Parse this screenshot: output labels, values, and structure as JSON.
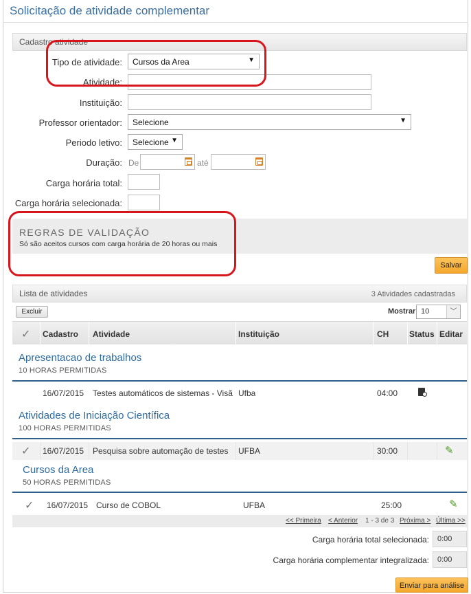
{
  "page": {
    "title": "Solicitação de atividade complementar"
  },
  "cadastro": {
    "section_title": "Cadastro atividade",
    "tipo_label": "Tipo de atividade:",
    "tipo_value": "Cursos da Area",
    "atividade_label": "Atividade:",
    "instituicao_label": "Instituição:",
    "professor_label": "Professor orientador:",
    "professor_value": "Selecione",
    "periodo_label": "Periodo letivo:",
    "periodo_value": "Selecione",
    "duracao_label": "Duração:",
    "de_label": "De",
    "ate_label": "até",
    "carga_total_label": "Carga horária total:",
    "carga_sel_label": "Carga horária selecionada:"
  },
  "regras": {
    "title": "REGRAS DE VALIDAÇÃO",
    "text": "Só são aceitos cursos com carga horária de 20 horas ou mais"
  },
  "save_label": "Salvar",
  "lista": {
    "section_title": "Lista de atividades",
    "count_text": "3 Atividades cadastradas",
    "excluir_label": "Excluir",
    "mostrar_label": "Mostrar",
    "mostrar_value": "10",
    "columns": {
      "cadastro": "Cadastro",
      "atividade": "Atividade",
      "instituicao": "Instituição",
      "ch": "CH",
      "status": "Status",
      "editar": "Editar"
    },
    "groups": [
      {
        "title": "Apresentacao de trabalhos",
        "subtitle": "10 HORAS PERMITIDAS",
        "rows": [
          {
            "date": "16/07/2015",
            "activity": "Testes automáticos de sistemas - Visã...",
            "institution": "Ufba",
            "ch": "04:00",
            "checked": false,
            "status_icon": "document-search-icon",
            "editable": false
          }
        ]
      },
      {
        "title": "Atividades de Iniciação Científica",
        "subtitle": "100 HORAS PERMITIDAS",
        "rows": [
          {
            "date": "16/07/2015",
            "activity": "Pesquisa sobre automação de testes",
            "institution": "UFBA",
            "ch": "30:00",
            "checked": true,
            "status_icon": "",
            "editable": true
          }
        ]
      },
      {
        "title": "Cursos da Area",
        "subtitle": "50 HORAS PERMITIDAS",
        "rows": [
          {
            "date": "16/07/2015",
            "activity": "Curso de COBOL",
            "institution": "UFBA",
            "ch": "25:00",
            "checked": true,
            "status_icon": "",
            "editable": true
          }
        ]
      }
    ],
    "pager": {
      "first": "<< Primeira",
      "prev": "< Anterior",
      "info": "1 - 3 de 3",
      "next": "Próxima >",
      "last": "Última >>"
    }
  },
  "totals": {
    "selecionada_label": "Carga horária total selecionada:",
    "selecionada_value": "0:00",
    "integralizada_label": "Carga horária complementar integralizada:",
    "integralizada_value": "0:00"
  },
  "enviar_label": "Enviar para análise",
  "colors": {
    "title_blue": "#3a6f9e",
    "annotation_red": "#d6151c",
    "button_orange": "#f4a72c",
    "edit_green": "#4a9a1c"
  }
}
